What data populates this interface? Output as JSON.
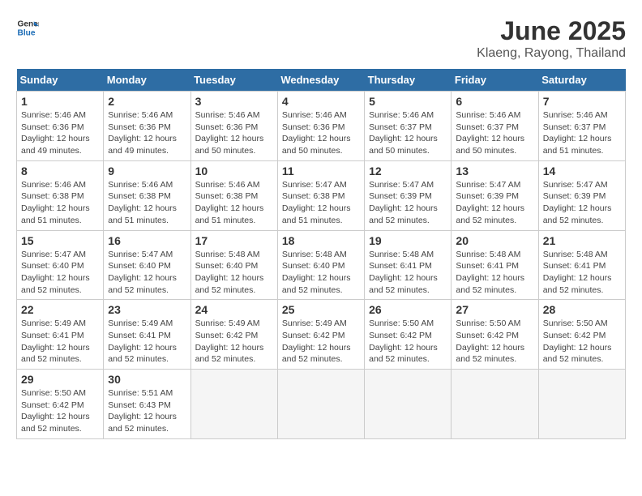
{
  "header": {
    "logo_general": "General",
    "logo_blue": "Blue",
    "title": "June 2025",
    "subtitle": "Klaeng, Rayong, Thailand"
  },
  "columns": [
    "Sunday",
    "Monday",
    "Tuesday",
    "Wednesday",
    "Thursday",
    "Friday",
    "Saturday"
  ],
  "weeks": [
    [
      {
        "day": "1",
        "sunrise": "5:46 AM",
        "sunset": "6:36 PM",
        "daylight": "12 hours and 49 minutes."
      },
      {
        "day": "2",
        "sunrise": "5:46 AM",
        "sunset": "6:36 PM",
        "daylight": "12 hours and 49 minutes."
      },
      {
        "day": "3",
        "sunrise": "5:46 AM",
        "sunset": "6:36 PM",
        "daylight": "12 hours and 50 minutes."
      },
      {
        "day": "4",
        "sunrise": "5:46 AM",
        "sunset": "6:36 PM",
        "daylight": "12 hours and 50 minutes."
      },
      {
        "day": "5",
        "sunrise": "5:46 AM",
        "sunset": "6:37 PM",
        "daylight": "12 hours and 50 minutes."
      },
      {
        "day": "6",
        "sunrise": "5:46 AM",
        "sunset": "6:37 PM",
        "daylight": "12 hours and 50 minutes."
      },
      {
        "day": "7",
        "sunrise": "5:46 AM",
        "sunset": "6:37 PM",
        "daylight": "12 hours and 51 minutes."
      }
    ],
    [
      {
        "day": "8",
        "sunrise": "5:46 AM",
        "sunset": "6:38 PM",
        "daylight": "12 hours and 51 minutes."
      },
      {
        "day": "9",
        "sunrise": "5:46 AM",
        "sunset": "6:38 PM",
        "daylight": "12 hours and 51 minutes."
      },
      {
        "day": "10",
        "sunrise": "5:46 AM",
        "sunset": "6:38 PM",
        "daylight": "12 hours and 51 minutes."
      },
      {
        "day": "11",
        "sunrise": "5:47 AM",
        "sunset": "6:38 PM",
        "daylight": "12 hours and 51 minutes."
      },
      {
        "day": "12",
        "sunrise": "5:47 AM",
        "sunset": "6:39 PM",
        "daylight": "12 hours and 52 minutes."
      },
      {
        "day": "13",
        "sunrise": "5:47 AM",
        "sunset": "6:39 PM",
        "daylight": "12 hours and 52 minutes."
      },
      {
        "day": "14",
        "sunrise": "5:47 AM",
        "sunset": "6:39 PM",
        "daylight": "12 hours and 52 minutes."
      }
    ],
    [
      {
        "day": "15",
        "sunrise": "5:47 AM",
        "sunset": "6:40 PM",
        "daylight": "12 hours and 52 minutes."
      },
      {
        "day": "16",
        "sunrise": "5:47 AM",
        "sunset": "6:40 PM",
        "daylight": "12 hours and 52 minutes."
      },
      {
        "day": "17",
        "sunrise": "5:48 AM",
        "sunset": "6:40 PM",
        "daylight": "12 hours and 52 minutes."
      },
      {
        "day": "18",
        "sunrise": "5:48 AM",
        "sunset": "6:40 PM",
        "daylight": "12 hours and 52 minutes."
      },
      {
        "day": "19",
        "sunrise": "5:48 AM",
        "sunset": "6:41 PM",
        "daylight": "12 hours and 52 minutes."
      },
      {
        "day": "20",
        "sunrise": "5:48 AM",
        "sunset": "6:41 PM",
        "daylight": "12 hours and 52 minutes."
      },
      {
        "day": "21",
        "sunrise": "5:48 AM",
        "sunset": "6:41 PM",
        "daylight": "12 hours and 52 minutes."
      }
    ],
    [
      {
        "day": "22",
        "sunrise": "5:49 AM",
        "sunset": "6:41 PM",
        "daylight": "12 hours and 52 minutes."
      },
      {
        "day": "23",
        "sunrise": "5:49 AM",
        "sunset": "6:41 PM",
        "daylight": "12 hours and 52 minutes."
      },
      {
        "day": "24",
        "sunrise": "5:49 AM",
        "sunset": "6:42 PM",
        "daylight": "12 hours and 52 minutes."
      },
      {
        "day": "25",
        "sunrise": "5:49 AM",
        "sunset": "6:42 PM",
        "daylight": "12 hours and 52 minutes."
      },
      {
        "day": "26",
        "sunrise": "5:50 AM",
        "sunset": "6:42 PM",
        "daylight": "12 hours and 52 minutes."
      },
      {
        "day": "27",
        "sunrise": "5:50 AM",
        "sunset": "6:42 PM",
        "daylight": "12 hours and 52 minutes."
      },
      {
        "day": "28",
        "sunrise": "5:50 AM",
        "sunset": "6:42 PM",
        "daylight": "12 hours and 52 minutes."
      }
    ],
    [
      {
        "day": "29",
        "sunrise": "5:50 AM",
        "sunset": "6:42 PM",
        "daylight": "12 hours and 52 minutes."
      },
      {
        "day": "30",
        "sunrise": "5:51 AM",
        "sunset": "6:43 PM",
        "daylight": "12 hours and 52 minutes."
      },
      null,
      null,
      null,
      null,
      null
    ]
  ],
  "labels": {
    "sunrise": "Sunrise:",
    "sunset": "Sunset:",
    "daylight": "Daylight:"
  }
}
